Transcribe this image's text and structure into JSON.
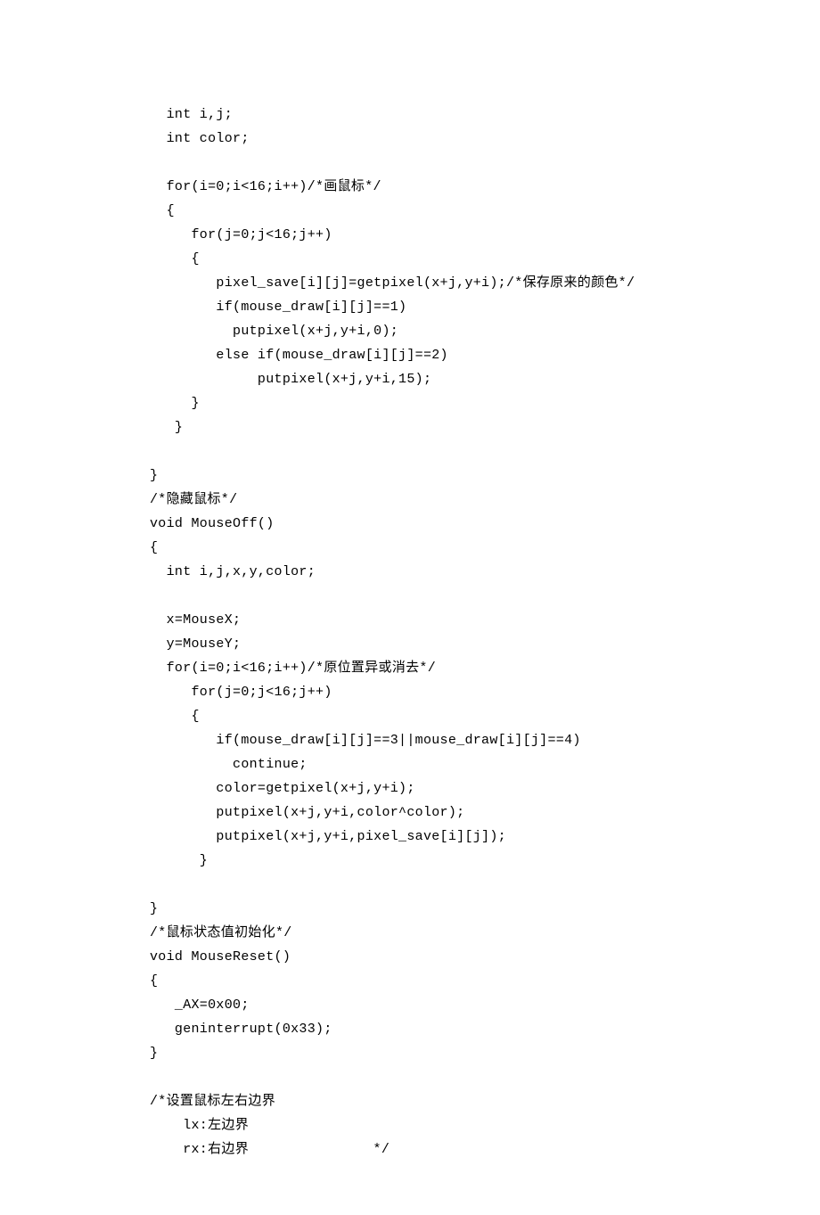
{
  "code": {
    "lines": [
      "  int i,j;",
      "  int color;",
      "",
      "  for(i=0;i<16;i++)/*画鼠标*/",
      "  {",
      "     for(j=0;j<16;j++)",
      "     {",
      "        pixel_save[i][j]=getpixel(x+j,y+i);/*保存原来的颜色*/",
      "        if(mouse_draw[i][j]==1)",
      "          putpixel(x+j,y+i,0);",
      "        else if(mouse_draw[i][j]==2)",
      "             putpixel(x+j,y+i,15);",
      "     }",
      "   }",
      "",
      "}",
      "/*隐藏鼠标*/",
      "void MouseOff()",
      "{",
      "  int i,j,x,y,color;",
      "",
      "  x=MouseX;",
      "  y=MouseY;",
      "  for(i=0;i<16;i++)/*原位置异或消去*/",
      "     for(j=0;j<16;j++)",
      "     {",
      "        if(mouse_draw[i][j]==3||mouse_draw[i][j]==4)",
      "          continue;",
      "        color=getpixel(x+j,y+i);",
      "        putpixel(x+j,y+i,color^color);",
      "        putpixel(x+j,y+i,pixel_save[i][j]);",
      "      }",
      "",
      "}",
      "/*鼠标状态值初始化*/",
      "void MouseReset()",
      "{",
      "   _AX=0x00;",
      "   geninterrupt(0x33);",
      "}",
      "",
      "/*设置鼠标左右边界",
      "    lx:左边界",
      "    rx:右边界               */"
    ]
  }
}
